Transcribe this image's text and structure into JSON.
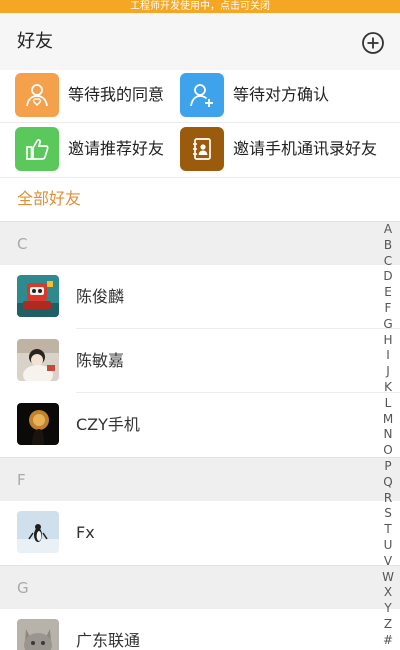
{
  "banner": {
    "text": "工程师开发使用中，点击可关闭"
  },
  "header": {
    "title": "好友",
    "add_icon": "plus-circle-icon"
  },
  "quick_actions": [
    {
      "label": "等待我的同意",
      "icon": "person-heart-icon",
      "color": "#f5a04a"
    },
    {
      "label": "等待对方确认",
      "icon": "add-person-icon",
      "color": "#3ea3ea"
    },
    {
      "label": "邀请推荐好友",
      "icon": "thumbs-up-icon",
      "color": "#5ac85a"
    },
    {
      "label": "邀请手机通讯录好友",
      "icon": "contact-book-icon",
      "color": "#9a5c0c"
    }
  ],
  "all_friends_label": "全部好友",
  "sections": [
    {
      "letter": "C",
      "contacts": [
        {
          "name": "陈俊麟",
          "avatar": "robot-avatar"
        },
        {
          "name": "陈敏嘉",
          "avatar": "person-avatar"
        },
        {
          "name": "CZY手机",
          "avatar": "night-avatar"
        }
      ]
    },
    {
      "letter": "F",
      "contacts": [
        {
          "name": "Fx",
          "avatar": "penguin-avatar"
        }
      ]
    },
    {
      "letter": "G",
      "contacts": [
        {
          "name": "广东联通",
          "avatar": "cat-avatar"
        }
      ]
    }
  ],
  "index_letters": [
    "A",
    "B",
    "C",
    "D",
    "E",
    "F",
    "G",
    "H",
    "I",
    "J",
    "K",
    "L",
    "M",
    "N",
    "O",
    "P",
    "Q",
    "R",
    "S",
    "T",
    "U",
    "V",
    "W",
    "X",
    "Y",
    "Z",
    "#"
  ],
  "colors": {
    "banner": "#f5a623",
    "accent": "#e0903a"
  }
}
